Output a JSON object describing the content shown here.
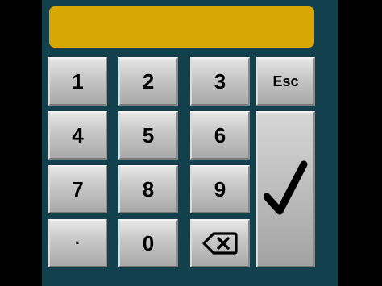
{
  "display": {
    "value": "",
    "color": "#d9a703"
  },
  "panel_color": "#12404d",
  "keys": {
    "k1": "1",
    "k2": "2",
    "k3": "3",
    "esc": "Esc",
    "k4": "4",
    "k5": "5",
    "k6": "6",
    "k7": "7",
    "k8": "8",
    "k9": "9",
    "dot": "·",
    "k0": "0"
  },
  "icons": {
    "backspace": "backspace-icon",
    "enter": "checkmark-icon"
  }
}
